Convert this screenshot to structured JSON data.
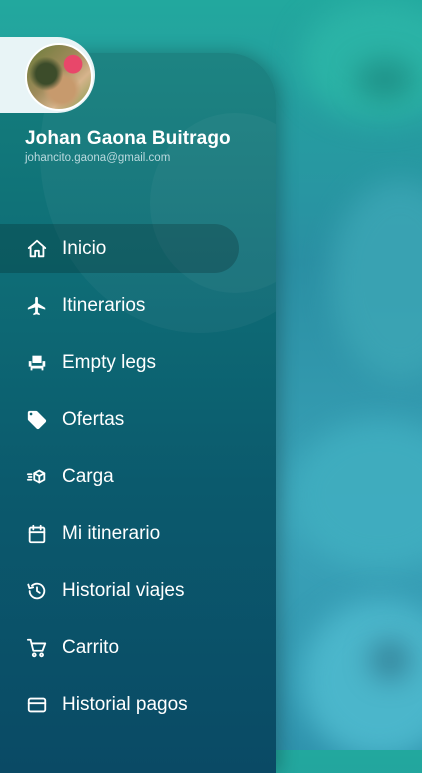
{
  "profile": {
    "name": "Johan Gaona Buitrago",
    "email": "johancito.gaona@gmail.com"
  },
  "menu": {
    "items": [
      {
        "label": "Inicio",
        "icon": "home-icon",
        "active": true
      },
      {
        "label": "Itinerarios",
        "icon": "airplane-icon",
        "active": false
      },
      {
        "label": "Empty legs",
        "icon": "seat-icon",
        "active": false
      },
      {
        "label": "Ofertas",
        "icon": "tag-icon",
        "active": false
      },
      {
        "label": "Carga",
        "icon": "cargo-icon",
        "active": false
      },
      {
        "label": "Mi itinerario",
        "icon": "calendar-icon",
        "active": false
      },
      {
        "label": "Historial viajes",
        "icon": "history-icon",
        "active": false
      },
      {
        "label": "Carrito",
        "icon": "cart-icon",
        "active": false
      },
      {
        "label": "Historial pagos",
        "icon": "credit-card-icon",
        "active": false
      }
    ]
  },
  "colors": {
    "drawer_top": "#147f7d",
    "drawer_bottom": "#0a4a65",
    "text": "#ffffff",
    "email_text": "#b9d9de",
    "avatar_tab": "#e8f4f6"
  }
}
